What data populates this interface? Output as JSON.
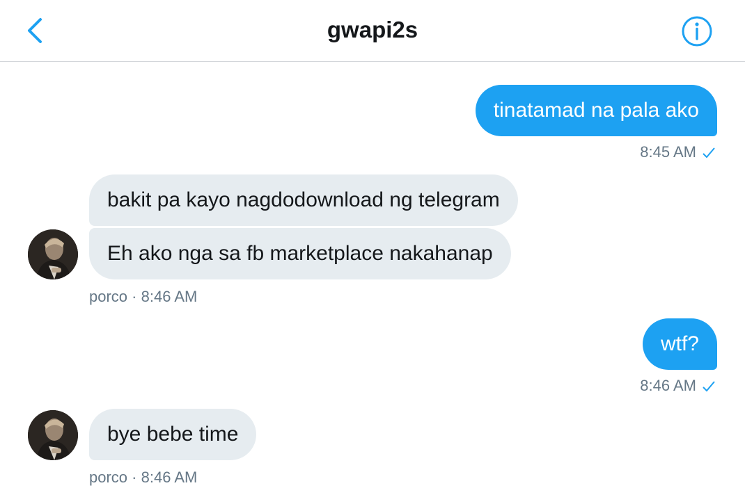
{
  "header": {
    "title": "gwapi2s",
    "back_icon": "chevron-left-icon",
    "info_icon": "info-icon",
    "accent": "#1da1f2"
  },
  "messages": [
    {
      "direction": "outgoing",
      "text": "tinatamad na pala ako",
      "time": "8:45 AM",
      "read_icon": "check-icon"
    },
    {
      "direction": "incoming",
      "lines": [
        "bakit pa kayo nagdodownload ng telegram",
        "Eh ako nga sa fb marketplace nakahanap"
      ],
      "sender": "porco",
      "separator": "·",
      "time": "8:46 AM"
    },
    {
      "direction": "outgoing",
      "text": "wtf?",
      "time": "8:46 AM",
      "read_icon": "check-icon"
    },
    {
      "direction": "incoming",
      "lines": [
        "bye bebe time"
      ],
      "sender": "porco",
      "separator": "·",
      "time": "8:46 AM"
    }
  ],
  "colors": {
    "outgoing_bubble": "#1da1f2",
    "incoming_bubble": "#e6ecf0",
    "meta_text": "#657786"
  }
}
